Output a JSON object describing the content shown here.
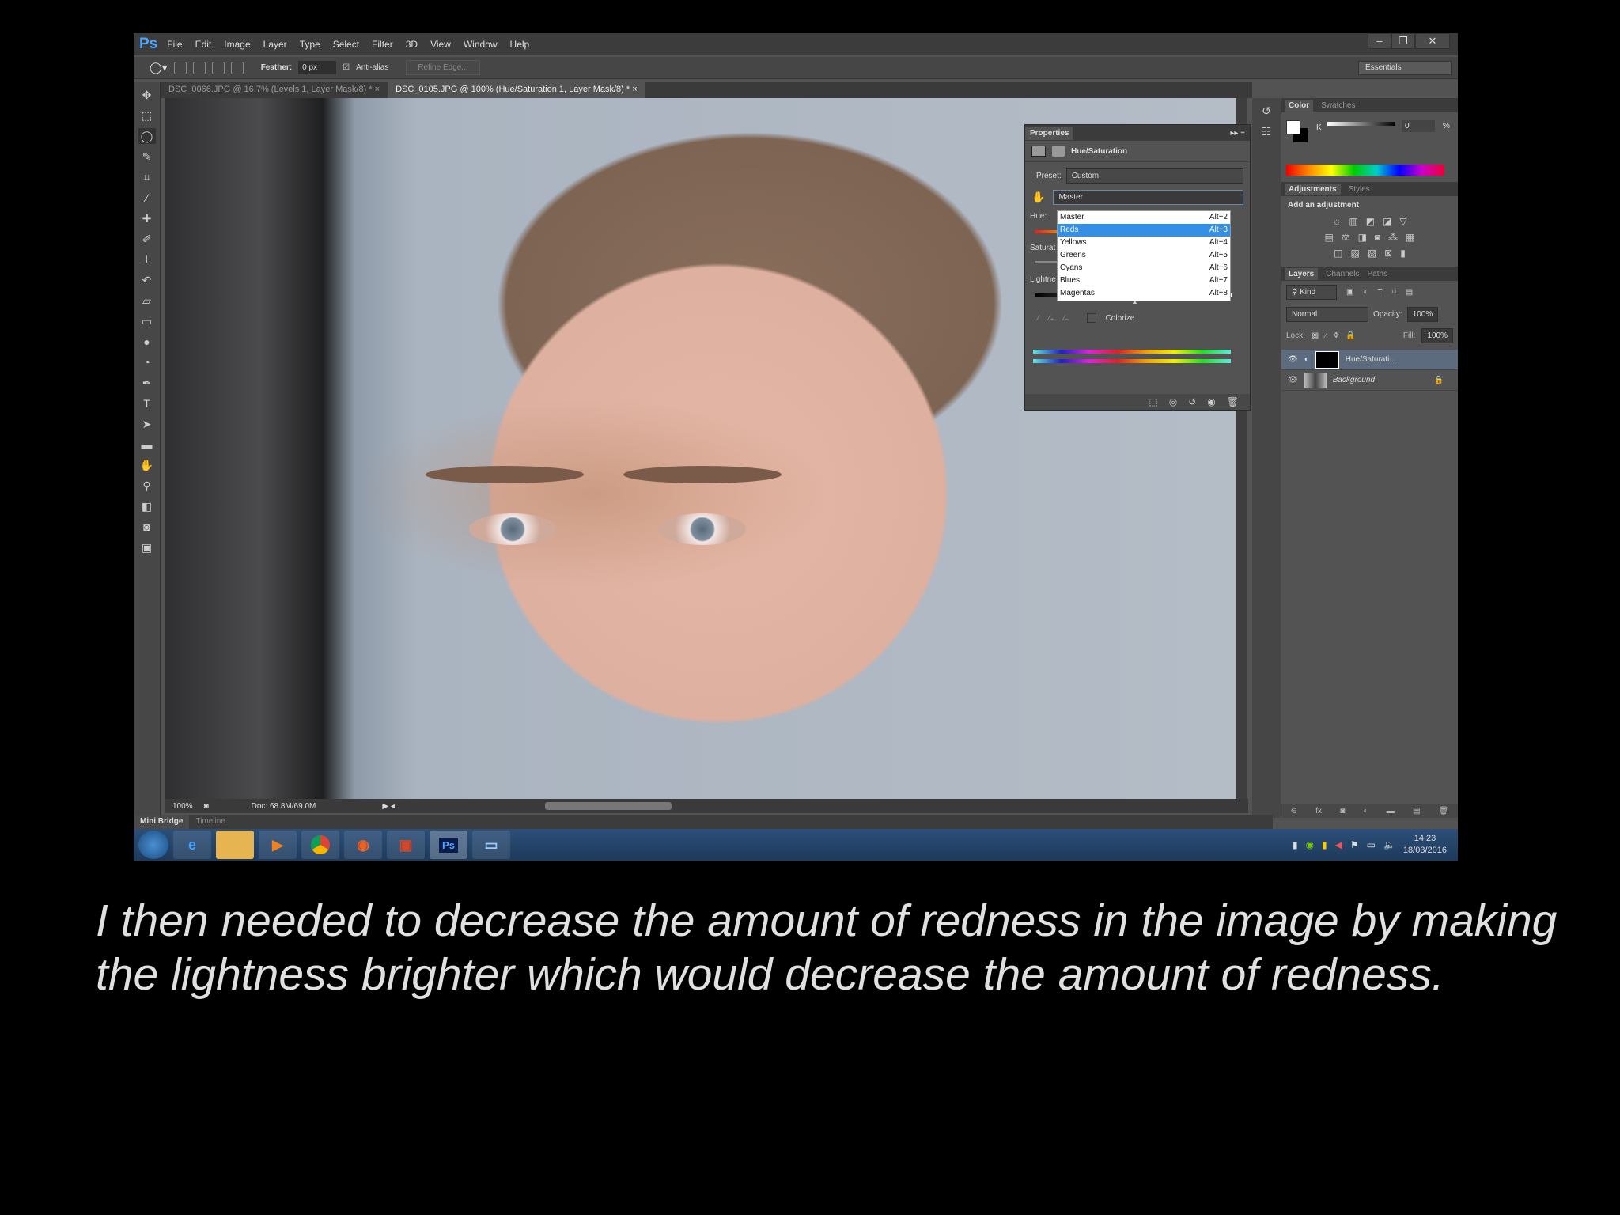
{
  "app": {
    "logo": "Ps",
    "menu": [
      "File",
      "Edit",
      "Image",
      "Layer",
      "Type",
      "Select",
      "Filter",
      "3D",
      "View",
      "Window",
      "Help"
    ],
    "window_buttons": [
      "–",
      "❐",
      "✕"
    ]
  },
  "options": {
    "feather_label": "Feather:",
    "feather_value": "0 px",
    "antialias_label": "Anti-alias",
    "antialias_checked": true,
    "refine_edge": "Refine Edge...",
    "workspace": "Essentials"
  },
  "tabs": [
    {
      "label": "DSC_0066.JPG @ 16.7% (Levels 1, Layer Mask/8) *",
      "close": "×"
    },
    {
      "label": "DSC_0105.JPG @ 100% (Hue/Saturation 1, Layer Mask/8) *",
      "close": "×"
    }
  ],
  "status": {
    "zoom": "100%",
    "doc": "Doc: 68.8M/69.0M"
  },
  "bottom_tabs": [
    "Mini Bridge",
    "Timeline"
  ],
  "properties": {
    "title": "Properties",
    "adjustment": "Hue/Saturation",
    "preset_label": "Preset:",
    "preset_value": "Custom",
    "channel_value": "Master",
    "hue_label": "Hue:",
    "saturation_label": "Saturat",
    "lightness_label": "Lightne",
    "colorize_label": "Colorize",
    "channel_options": [
      {
        "label": "Master",
        "shortcut": "Alt+2"
      },
      {
        "label": "Reds",
        "shortcut": "Alt+3"
      },
      {
        "label": "Yellows",
        "shortcut": "Alt+4"
      },
      {
        "label": "Greens",
        "shortcut": "Alt+5"
      },
      {
        "label": "Cyans",
        "shortcut": "Alt+6"
      },
      {
        "label": "Blues",
        "shortcut": "Alt+7"
      },
      {
        "label": "Magentas",
        "shortcut": "Alt+8"
      }
    ]
  },
  "color_panel": {
    "tabs": [
      "Color",
      "Swatches"
    ],
    "channel": "K",
    "value": "0",
    "unit": "%"
  },
  "adjustments_panel": {
    "tabs": [
      "Adjustments",
      "Styles"
    ],
    "heading": "Add an adjustment"
  },
  "layers_panel": {
    "tabs": [
      "Layers",
      "Channels",
      "Paths"
    ],
    "filter": "Kind",
    "blend_mode": "Normal",
    "opacity_label": "Opacity:",
    "opacity": "100%",
    "lock_label": "Lock:",
    "fill_label": "Fill:",
    "fill": "100%",
    "layers": [
      {
        "name": "Hue/Saturati...",
        "selected": true
      },
      {
        "name": "Background",
        "selected": false
      }
    ]
  },
  "taskbar": {
    "time": "14:23",
    "date": "18/03/2016",
    "apps": [
      "ie",
      "explorer",
      "media-player",
      "chrome",
      "firefox",
      "powerpoint",
      "photoshop",
      "photos"
    ],
    "ps_label": "Ps"
  },
  "caption": "I then needed to decrease the amount of redness in the image by making the lightness brighter which would decrease the amount of redness."
}
